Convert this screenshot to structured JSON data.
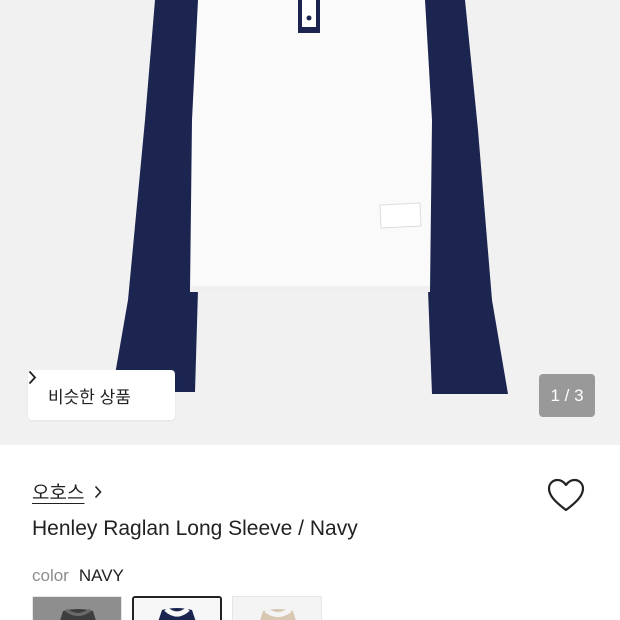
{
  "product_image": {
    "colors": {
      "background": "#f1f1f1",
      "sleeve": "#1b2550",
      "body": "#fafafa",
      "placket": "#1b2550"
    }
  },
  "similar_button": {
    "label": "비슷한 상품",
    "icon": "chevron-right-icon"
  },
  "pager": {
    "text": "1 / 3"
  },
  "brand": {
    "name": "오호스",
    "icon": "chevron-right-icon"
  },
  "wishlist": {
    "icon": "heart-outline-icon"
  },
  "product": {
    "title": "Henley Raglan Long Sleeve / Navy"
  },
  "color_option": {
    "label": "color",
    "value": "NAVY"
  },
  "swatches": [
    {
      "name": "gray",
      "selected": false,
      "bg": "#8e8e8e",
      "shirt": "#3e3e3e"
    },
    {
      "name": "navy",
      "selected": true,
      "bg": "#f7f7f7",
      "shirt": "#1b2550"
    },
    {
      "name": "beige",
      "selected": false,
      "bg": "#f4f4f4",
      "shirt": "#d8c8b2"
    }
  ]
}
